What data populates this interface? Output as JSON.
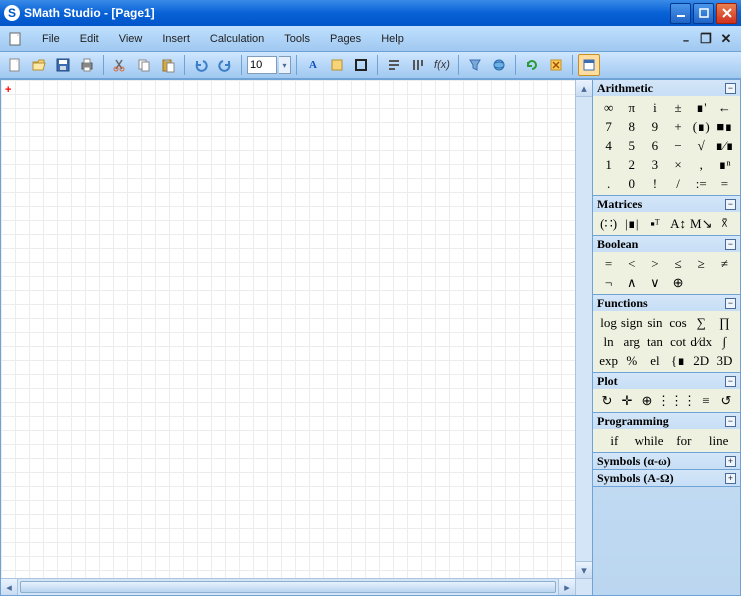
{
  "title": "SMath Studio - [Page1]",
  "appicon": "S",
  "menus": [
    "File",
    "Edit",
    "View",
    "Insert",
    "Calculation",
    "Tools",
    "Pages",
    "Help"
  ],
  "fontsize": "10",
  "panels": {
    "arithmetic": {
      "title": "Arithmetic",
      "state": "−",
      "cells": [
        "∞",
        "π",
        "i",
        "±",
        "∎'",
        "←",
        "7",
        "8",
        "9",
        "+",
        "(∎)",
        "■∎",
        "4",
        "5",
        "6",
        "−",
        "√",
        "∎⁄∎",
        "1",
        "2",
        "3",
        "×",
        ",",
        "∎ⁿ",
        ".",
        "0",
        "!",
        "/",
        ":=",
        "="
      ]
    },
    "matrices": {
      "title": "Matrices",
      "state": "−",
      "cells": [
        "(∷)",
        "|∎|",
        "▪ᵀ",
        "A↕",
        "M↘",
        "☓̄"
      ]
    },
    "boolean": {
      "title": "Boolean",
      "state": "−",
      "cells": [
        "=",
        "<",
        ">",
        "≤",
        "≥",
        "≠",
        "¬",
        "∧",
        "∨",
        "⊕",
        "",
        ""
      ]
    },
    "functions": {
      "title": "Functions",
      "state": "−",
      "cells": [
        "log",
        "sign",
        "sin",
        "cos",
        "∑",
        "∏",
        "ln",
        "arg",
        "tan",
        "cot",
        "d⁄dx",
        "∫",
        "exp",
        "%",
        "el",
        "{∎",
        "2D",
        "3D"
      ]
    },
    "plot": {
      "title": "Plot",
      "state": "−",
      "cells": [
        "↻",
        "✛",
        "⊕",
        "⋮⋮⋮",
        "≡",
        "↺"
      ]
    },
    "programming": {
      "title": "Programming",
      "state": "−",
      "cells": [
        "if",
        "while",
        "for",
        "line"
      ]
    },
    "symbols_lower": {
      "title": "Symbols (α-ω)",
      "state": "+"
    },
    "symbols_upper": {
      "title": "Symbols (Α-Ω)",
      "state": "+"
    }
  }
}
